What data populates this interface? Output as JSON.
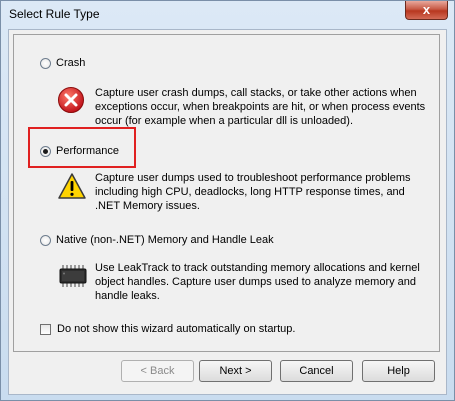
{
  "window": {
    "title": "Select Rule Type",
    "close_glyph": "x"
  },
  "options": [
    {
      "label": "Crash",
      "checked": false,
      "icon": "error-icon",
      "description": "Capture user crash dumps, call stacks, or take other actions when exceptions occur, when breakpoints are hit, or when process events occur (for example when a particular dll is unloaded)."
    },
    {
      "label": "Performance",
      "checked": true,
      "icon": "warning-icon",
      "description": "Capture user dumps used to troubleshoot performance problems including high CPU, deadlocks, long HTTP response times, and .NET Memory issues."
    },
    {
      "label": "Native (non-.NET) Memory and Handle Leak",
      "checked": false,
      "icon": "chip-icon",
      "description": "Use LeakTrack to track outstanding memory allocations and kernel object handles. Capture user dumps used to analyze memory and handle leaks."
    }
  ],
  "startup_checkbox": {
    "label": "Do not show this wizard automatically on startup.",
    "checked": false
  },
  "buttons": {
    "back": "< Back",
    "next": "Next >",
    "cancel": "Cancel",
    "help": "Help"
  },
  "colors": {
    "highlight": "#e02020"
  }
}
